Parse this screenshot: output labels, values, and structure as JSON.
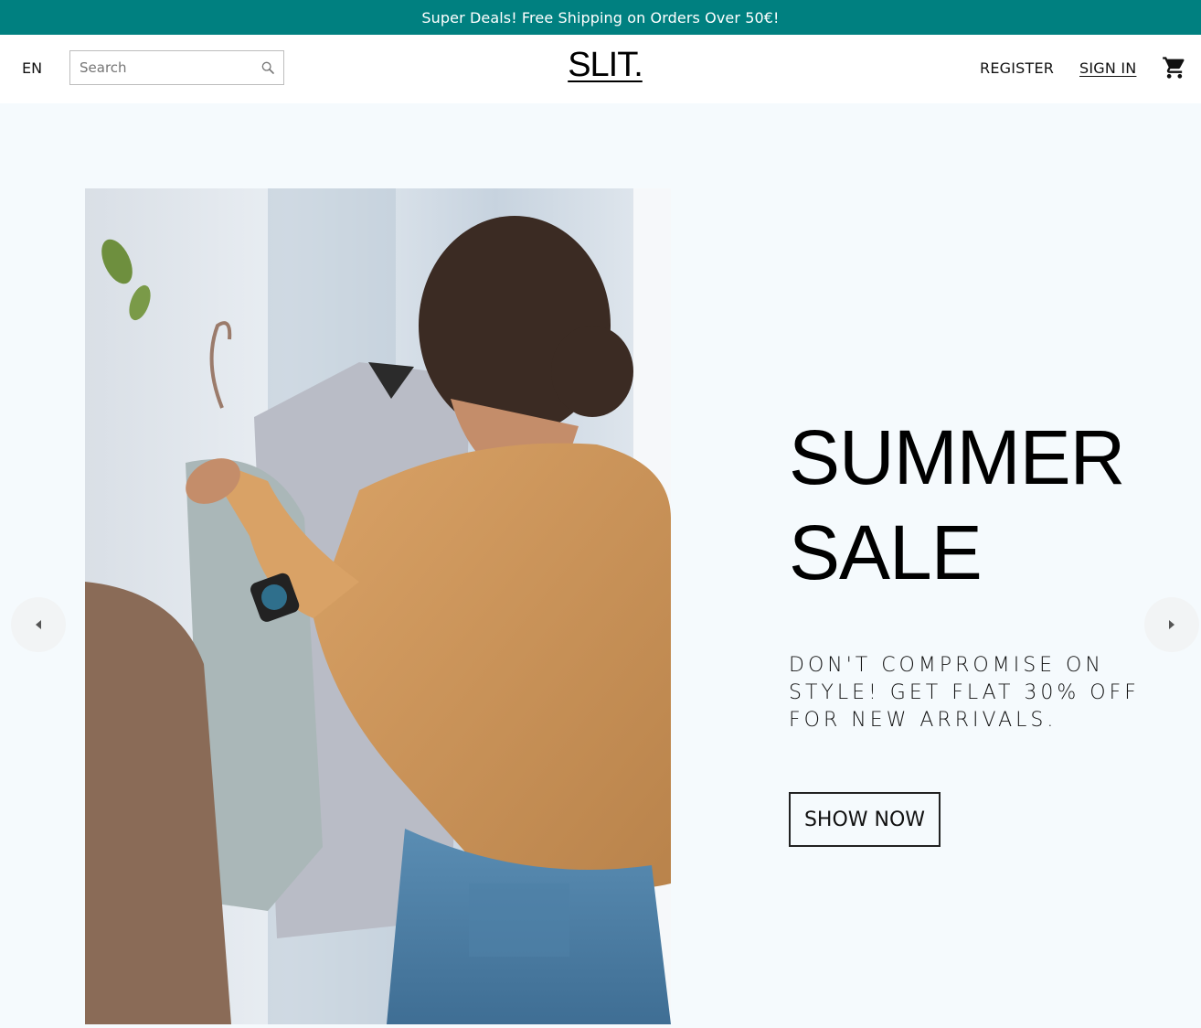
{
  "announcement": {
    "text": "Super Deals! Free Shipping on Orders Over 50€!"
  },
  "nav": {
    "language": "EN",
    "search_placeholder": "Search",
    "logo": "SLIT.",
    "register": "REGISTER",
    "sign_in": "SIGN IN",
    "cart_icon": "shopping-cart-icon",
    "search_icon": "magnifier-icon"
  },
  "hero": {
    "title_line1": "SUMMER",
    "title_line2": "SALE",
    "description": "DON'T COMPROMISE ON STYLE! GET FLAT 30% OFF FOR NEW ARRIVALS.",
    "button": "SHOW NOW",
    "prev_icon": "arrow-left-icon",
    "next_icon": "arrow-right-icon"
  },
  "colors": {
    "announcement_bg": "#008080",
    "hero_bg": "#f5fafd"
  }
}
